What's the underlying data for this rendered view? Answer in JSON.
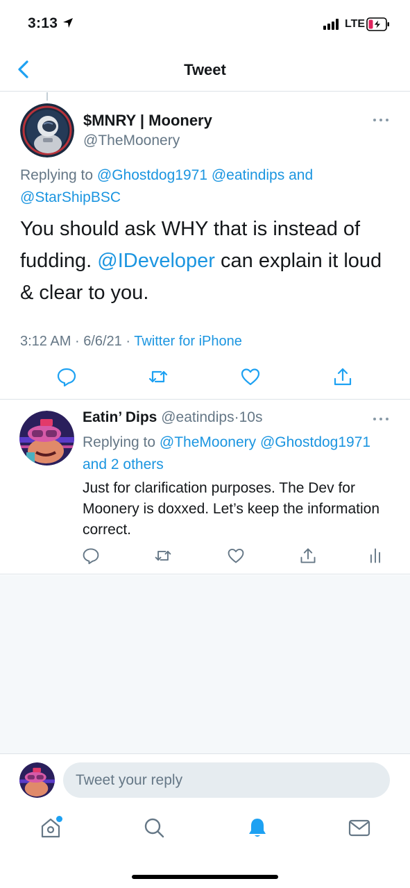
{
  "status_bar": {
    "time": "3:13",
    "network": "LTE"
  },
  "nav": {
    "title": "Tweet"
  },
  "main_tweet": {
    "author_name": "$MNRY | Moonery",
    "author_handle": "@TheMoonery",
    "replying_prefix": "Replying to",
    "replying_user_1": "@Ghostdog1971",
    "replying_user_2": "@eatindips",
    "replying_and": "and",
    "replying_user_3": "@StarShipBSC",
    "text_part1": "You should ask WHY that is instead of fudding. ",
    "mention": "@IDeveloper",
    "text_part2": " can explain it loud & clear to you.",
    "time": "3:12 AM",
    "sep": "·",
    "date": "6/6/21",
    "source": "Twitter for iPhone"
  },
  "reply_tweet": {
    "author_name": "Eatin’ Dips",
    "author_handle": "@eatindips",
    "sep": "·",
    "age": "10s",
    "replying_prefix": "Replying to",
    "replying_user_1": "@TheMoonery",
    "replying_user_2": "@Ghostdog1971",
    "replying_and": "and",
    "replying_others": "2 others",
    "text": "Just for clarification purposes. The Dev for Moonery is doxxed. Let’s keep the information correct."
  },
  "reply_bar": {
    "placeholder": "Tweet your reply"
  },
  "icons": {
    "back": "chevron-left-icon",
    "more": "more-dots-icon",
    "reply": "comment-icon",
    "retweet": "retweet-icon",
    "like": "heart-icon",
    "share": "share-icon",
    "analytics": "analytics-icon",
    "home": "home-icon",
    "search": "search-icon",
    "notifications": "bell-icon",
    "messages": "mail-icon"
  },
  "colors": {
    "accent": "#1da1f2",
    "link": "#1b95e0",
    "text": "#14171a",
    "muted": "#657786",
    "battery_low": "#e0245e"
  }
}
